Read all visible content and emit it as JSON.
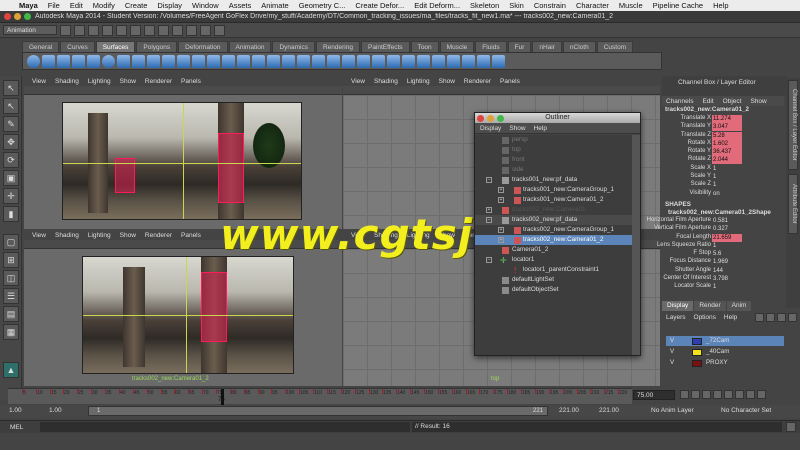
{
  "mac_menu": [
    "Maya",
    "File",
    "Edit",
    "Modify",
    "Create",
    "Display",
    "Window",
    "Assets",
    "Animate",
    "Geometry C...",
    "Create Defor...",
    "Edit Deform...",
    "Skeleton",
    "Skin",
    "Constrain",
    "Character",
    "Muscle",
    "Pipeline Cache",
    "Help"
  ],
  "window_title": "Autodesk Maya 2014 - Student Version: /Volumes/FreeAgent GoFlex Drive/my_stuff/Academy/DT/Common_tracking_issues/ma_files/tracks_fit_new1.ma*  ---  tracks002_new:Camera01_2",
  "mode_menu": "Animation",
  "shelf_tabs": [
    "General",
    "Curves",
    "Surfaces",
    "Polygons",
    "Deformation",
    "Animation",
    "Dynamics",
    "Rendering",
    "PaintEffects",
    "Toon",
    "Muscle",
    "Fluids",
    "Fur",
    "nHair",
    "nCloth",
    "Custom"
  ],
  "active_shelf": "Surfaces",
  "viewport_menu": [
    "View",
    "Shading",
    "Lighting",
    "Show",
    "Renderer",
    "Panels"
  ],
  "viewports": {
    "bottom_left_camera": "tracks002_new:Camera01_2",
    "bottom_right_camera": "top"
  },
  "outliner": {
    "title": "Outliner",
    "menu": [
      "Display",
      "Show",
      "Help"
    ],
    "rows": [
      {
        "label": "persp",
        "dim": true
      },
      {
        "label": "top",
        "dim": true
      },
      {
        "label": "front",
        "dim": true
      },
      {
        "label": "side",
        "dim": true
      },
      {
        "label": "tracks001_new:pf_data"
      },
      {
        "label": "tracks001_new:CameraGroup_1"
      },
      {
        "label": "tracks001_new:Camera01_2"
      },
      {
        "label": "tracks002_new:Camera01"
      },
      {
        "label": "tracks002_new:pf_data"
      },
      {
        "label": "tracks002_new:CameraGroup_1"
      },
      {
        "label": "tracks002_new:Camera01_2",
        "selected": true
      },
      {
        "label": "Camera01_2"
      },
      {
        "label": "locator1"
      },
      {
        "label": "locator1_parentConstraint1"
      },
      {
        "label": "defaultLightSet"
      },
      {
        "label": "defaultObjectSet"
      }
    ]
  },
  "channel_box": {
    "header": "Channel Box / Layer Editor",
    "menu": [
      "Channels",
      "Edit",
      "Object",
      "Show"
    ],
    "object": "tracks002_new:Camera01_2",
    "channels": [
      {
        "label": "Translate X",
        "value": "11.274",
        "keyed": true
      },
      {
        "label": "Translate Y",
        "value": "3.047",
        "keyed": true
      },
      {
        "label": "Translate Z",
        "value": "5.28",
        "keyed": true
      },
      {
        "label": "Rotate X",
        "value": "1.602",
        "keyed": true
      },
      {
        "label": "Rotate Y",
        "value": "36.437",
        "keyed": true
      },
      {
        "label": "Rotate Z",
        "value": "2.044",
        "keyed": true
      },
      {
        "label": "Scale X",
        "value": "1",
        "keyed": false
      },
      {
        "label": "Scale Y",
        "value": "1",
        "keyed": false
      },
      {
        "label": "Scale Z",
        "value": "1",
        "keyed": false
      },
      {
        "label": "Visibility",
        "value": "on",
        "keyed": false
      }
    ],
    "shapes_header": "SHAPES",
    "shape_name": "tracks002_new:Camera01_2Shape",
    "shape_channels": [
      {
        "label": "Horizontal Film Aperture",
        "value": "0.581",
        "keyed": false
      },
      {
        "label": "Vertical Film Aperture",
        "value": "0.327",
        "keyed": false
      },
      {
        "label": "Focal Length",
        "value": "21.659",
        "keyed": true
      },
      {
        "label": "Lens Squeeze Ratio",
        "value": "1",
        "keyed": false
      },
      {
        "label": "F Stop",
        "value": "5.6",
        "keyed": false
      },
      {
        "label": "Focus Distance",
        "value": "1.969",
        "keyed": false
      },
      {
        "label": "Shutter Angle",
        "value": "144",
        "keyed": false
      },
      {
        "label": "Center Of Interest",
        "value": "3.798",
        "keyed": false
      },
      {
        "label": "Locator Scale",
        "value": "1",
        "keyed": false
      }
    ]
  },
  "side_tabs": [
    "Channel Box / Layer Editor",
    "Attribute Editor"
  ],
  "layer_editor": {
    "tabs": [
      "Display",
      "Render",
      "Anim"
    ],
    "active_tab": "Display",
    "menu": [
      "Layers",
      "Options",
      "Help"
    ],
    "layers": [
      {
        "v": "V",
        "name": "_72Cam",
        "color": "#2f3fb0",
        "selected": true
      },
      {
        "v": "V",
        "name": "_40Cam",
        "color": "#f4e21a",
        "selected": false
      },
      {
        "v": "V",
        "name": "PROXY",
        "color": "#7a1010",
        "selected": false
      }
    ]
  },
  "time_slider": {
    "current_frame": "75",
    "ticks": [
      "5",
      "10",
      "15",
      "20",
      "25",
      "30",
      "35",
      "40",
      "45",
      "50",
      "55",
      "60",
      "65",
      "70",
      "75",
      "80",
      "85",
      "90",
      "95",
      "100",
      "105",
      "110",
      "115",
      "120",
      "125",
      "130",
      "135",
      "140",
      "145",
      "150",
      "155",
      "160",
      "165",
      "170",
      "175",
      "180",
      "185",
      "190",
      "195",
      "200",
      "205",
      "210",
      "215",
      "220"
    ],
    "frame_field": "75.00"
  },
  "range": {
    "start_a": "1.00",
    "start_b": "1.00",
    "range_start": "1",
    "range_end": "221",
    "end_a": "221.00",
    "end_b": "221.00",
    "anim_layer": "No Anim Layer",
    "character_set": "No Character Set"
  },
  "command_line": {
    "label": "MEL",
    "result": "// Result: 16"
  },
  "watermark": "www.cgtsj.com"
}
